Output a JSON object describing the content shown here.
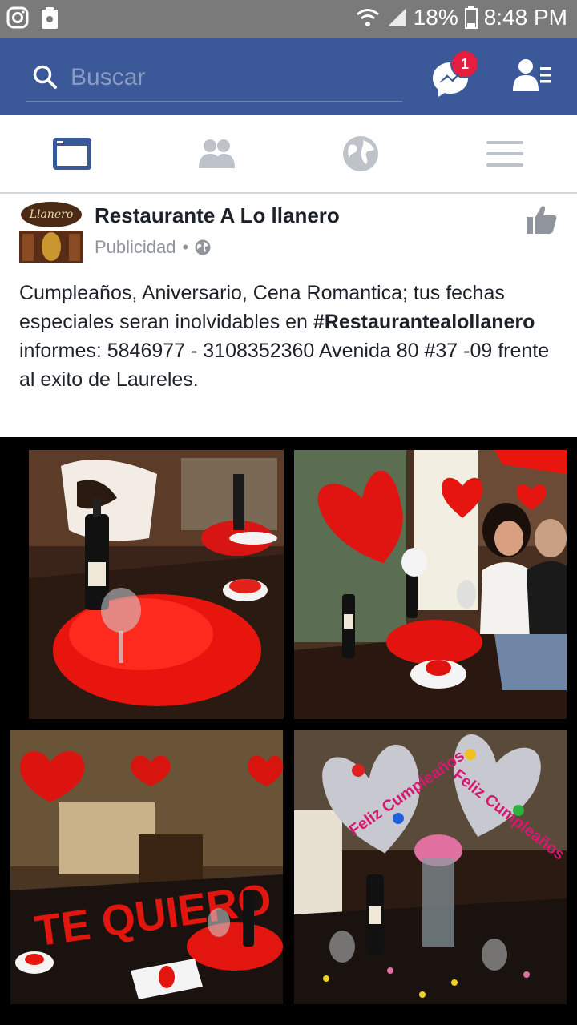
{
  "status_bar": {
    "battery": "18%",
    "time": "8:48 PM"
  },
  "header": {
    "search_placeholder": "Buscar",
    "messenger_badge": "1",
    "brand_color": "#3b5998"
  },
  "tabs": [
    {
      "id": "news-feed",
      "active": true
    },
    {
      "id": "friends",
      "active": false
    },
    {
      "id": "notifications",
      "active": false
    },
    {
      "id": "menu",
      "active": false
    }
  ],
  "post": {
    "page_name": "Restaurante A Lo llanero",
    "sponsored_label": "Publicidad",
    "separator": "•",
    "text_before": "Cumpleaños, Aniversario, Cena Romantica;  tus fechas especiales seran inolvidables en ",
    "hashtag": "#Restaurantealollanero",
    "text_after": " informes: 5846977 - 3108352360 Avenida 80 #37 -09 frente al exito de Laureles.",
    "avatar_logo_text": "Llanero",
    "balloon_text": "Feliz Cumpleaños"
  }
}
